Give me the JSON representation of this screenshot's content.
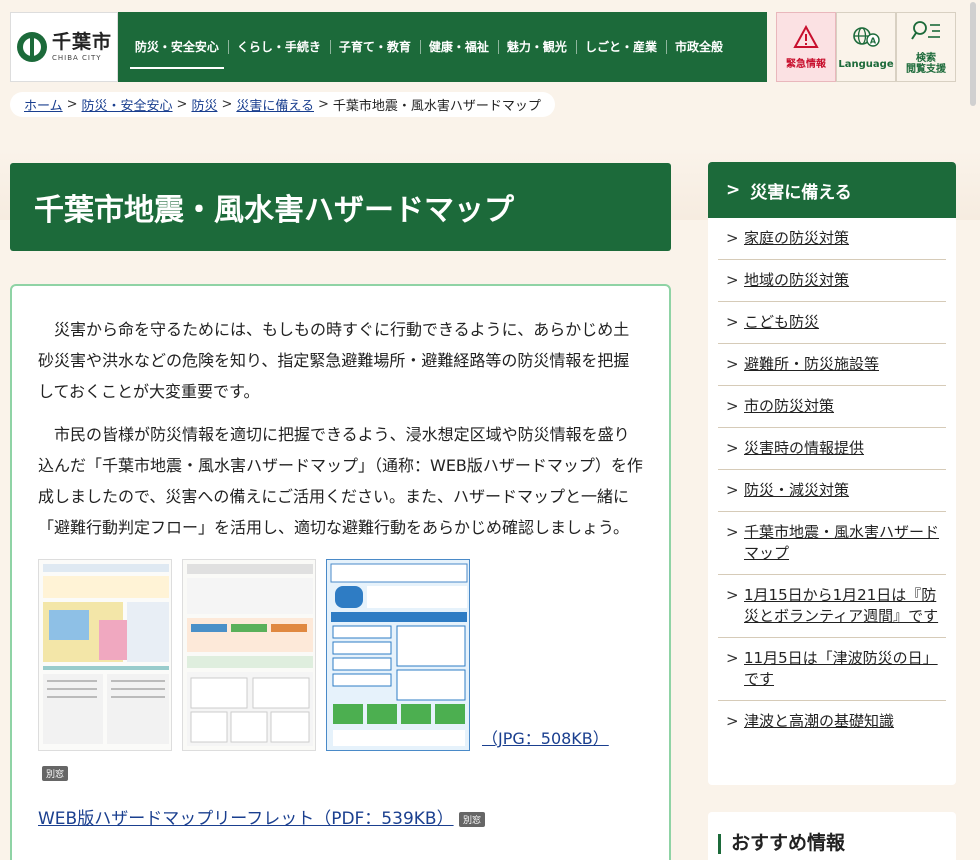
{
  "header": {
    "logo_ja": "千葉市",
    "logo_en": "CHIBA CITY",
    "nav": [
      "防災・安全安心",
      "くらし・手続き",
      "子育て・教育",
      "健康・福祉",
      "魅力・観光",
      "しごと・産業",
      "市政全般"
    ],
    "utility": {
      "emergency": "緊急情報",
      "language": "Language",
      "search_line1": "検索",
      "search_line2": "閲覧支援"
    }
  },
  "breadcrumb": {
    "items": [
      "ホーム",
      "防災・安全安心",
      "防災",
      "災害に備える"
    ],
    "current": "千葉市地震・風水害ハザードマップ",
    "separator": ">"
  },
  "page": {
    "title": "千葉市地震・風水害ハザードマップ",
    "paragraphs": [
      "災害から命を守るためには、もしもの時すぐに行動できるように、あらかじめ土砂災害や洪水などの危険を知り、指定緊急避難場所・避難経路等の防災情報を把握しておくことが大変重要です。",
      "市民の皆様が防災情報を適切に把握できるよう、浸水想定区域や防災情報を盛り込んだ「千葉市地震・風水害ハザードマップ」（通称：WEB版ハザードマップ）を作成しましたので、災害への備えにご活用ください。また、ハザードマップと一緒に「避難行動判定フロー」を活用し、適切な避難行動をあらかじめ確認しましょう。"
    ],
    "jpg_link": "（JPG：508KB）",
    "new_window": "別窓",
    "leaflet_link": "WEB版ハザードマップリーフレット（PDF：539KB）"
  },
  "side": {
    "heading": "災害に備える",
    "items": [
      "家庭の防災対策",
      "地域の防災対策",
      "こども防災",
      "避難所・防災施設等",
      "市の防災対策",
      "災害時の情報提供",
      "防災・減災対策",
      "千葉市地震・風水害ハザードマップ",
      "1月15日から1月21日は『防災とボランティア週間』です",
      "11月5日は「津波防災の日」です",
      "津波と高潮の基礎知識"
    ],
    "recommend": "おすすめ情報"
  },
  "colors": {
    "brand_green": "#1c6a3a",
    "emergency_red": "#c8102e",
    "link_blue": "#1a3f8f",
    "page_bg": "#faf3ea"
  }
}
